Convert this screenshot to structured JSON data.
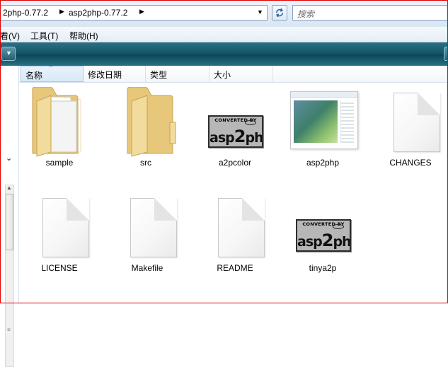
{
  "address": {
    "crumbs": [
      "2php-0.77.2",
      "asp2php-0.77.2"
    ],
    "search_placeholder": "搜索"
  },
  "menu": [
    "看(V)",
    "工具(T)",
    "帮助(H)"
  ],
  "columns": [
    "名称",
    "修改日期",
    "类型",
    "大小"
  ],
  "files": [
    {
      "name": "sample",
      "icon": "folder-icon"
    },
    {
      "name": "src",
      "icon": "folder-icon"
    },
    {
      "name": "a2pcolor",
      "icon": "asp2php-badge-icon"
    },
    {
      "name": "asp2php",
      "icon": "window-thumbnail-icon"
    },
    {
      "name": "CHANGES",
      "icon": "document-icon"
    },
    {
      "name": "LICENSE",
      "icon": "document-icon"
    },
    {
      "name": "Makefile",
      "icon": "document-icon"
    },
    {
      "name": "README",
      "icon": "document-icon"
    },
    {
      "name": "tinya2p",
      "icon": "asp2php-badge-icon"
    }
  ],
  "badge": {
    "top_text": "CONVERTED BY",
    "main_left": "asp",
    "main_mid": "2",
    "main_right": "php"
  },
  "colors": {
    "toolbar": "#14566b",
    "frame": "#e00000"
  }
}
